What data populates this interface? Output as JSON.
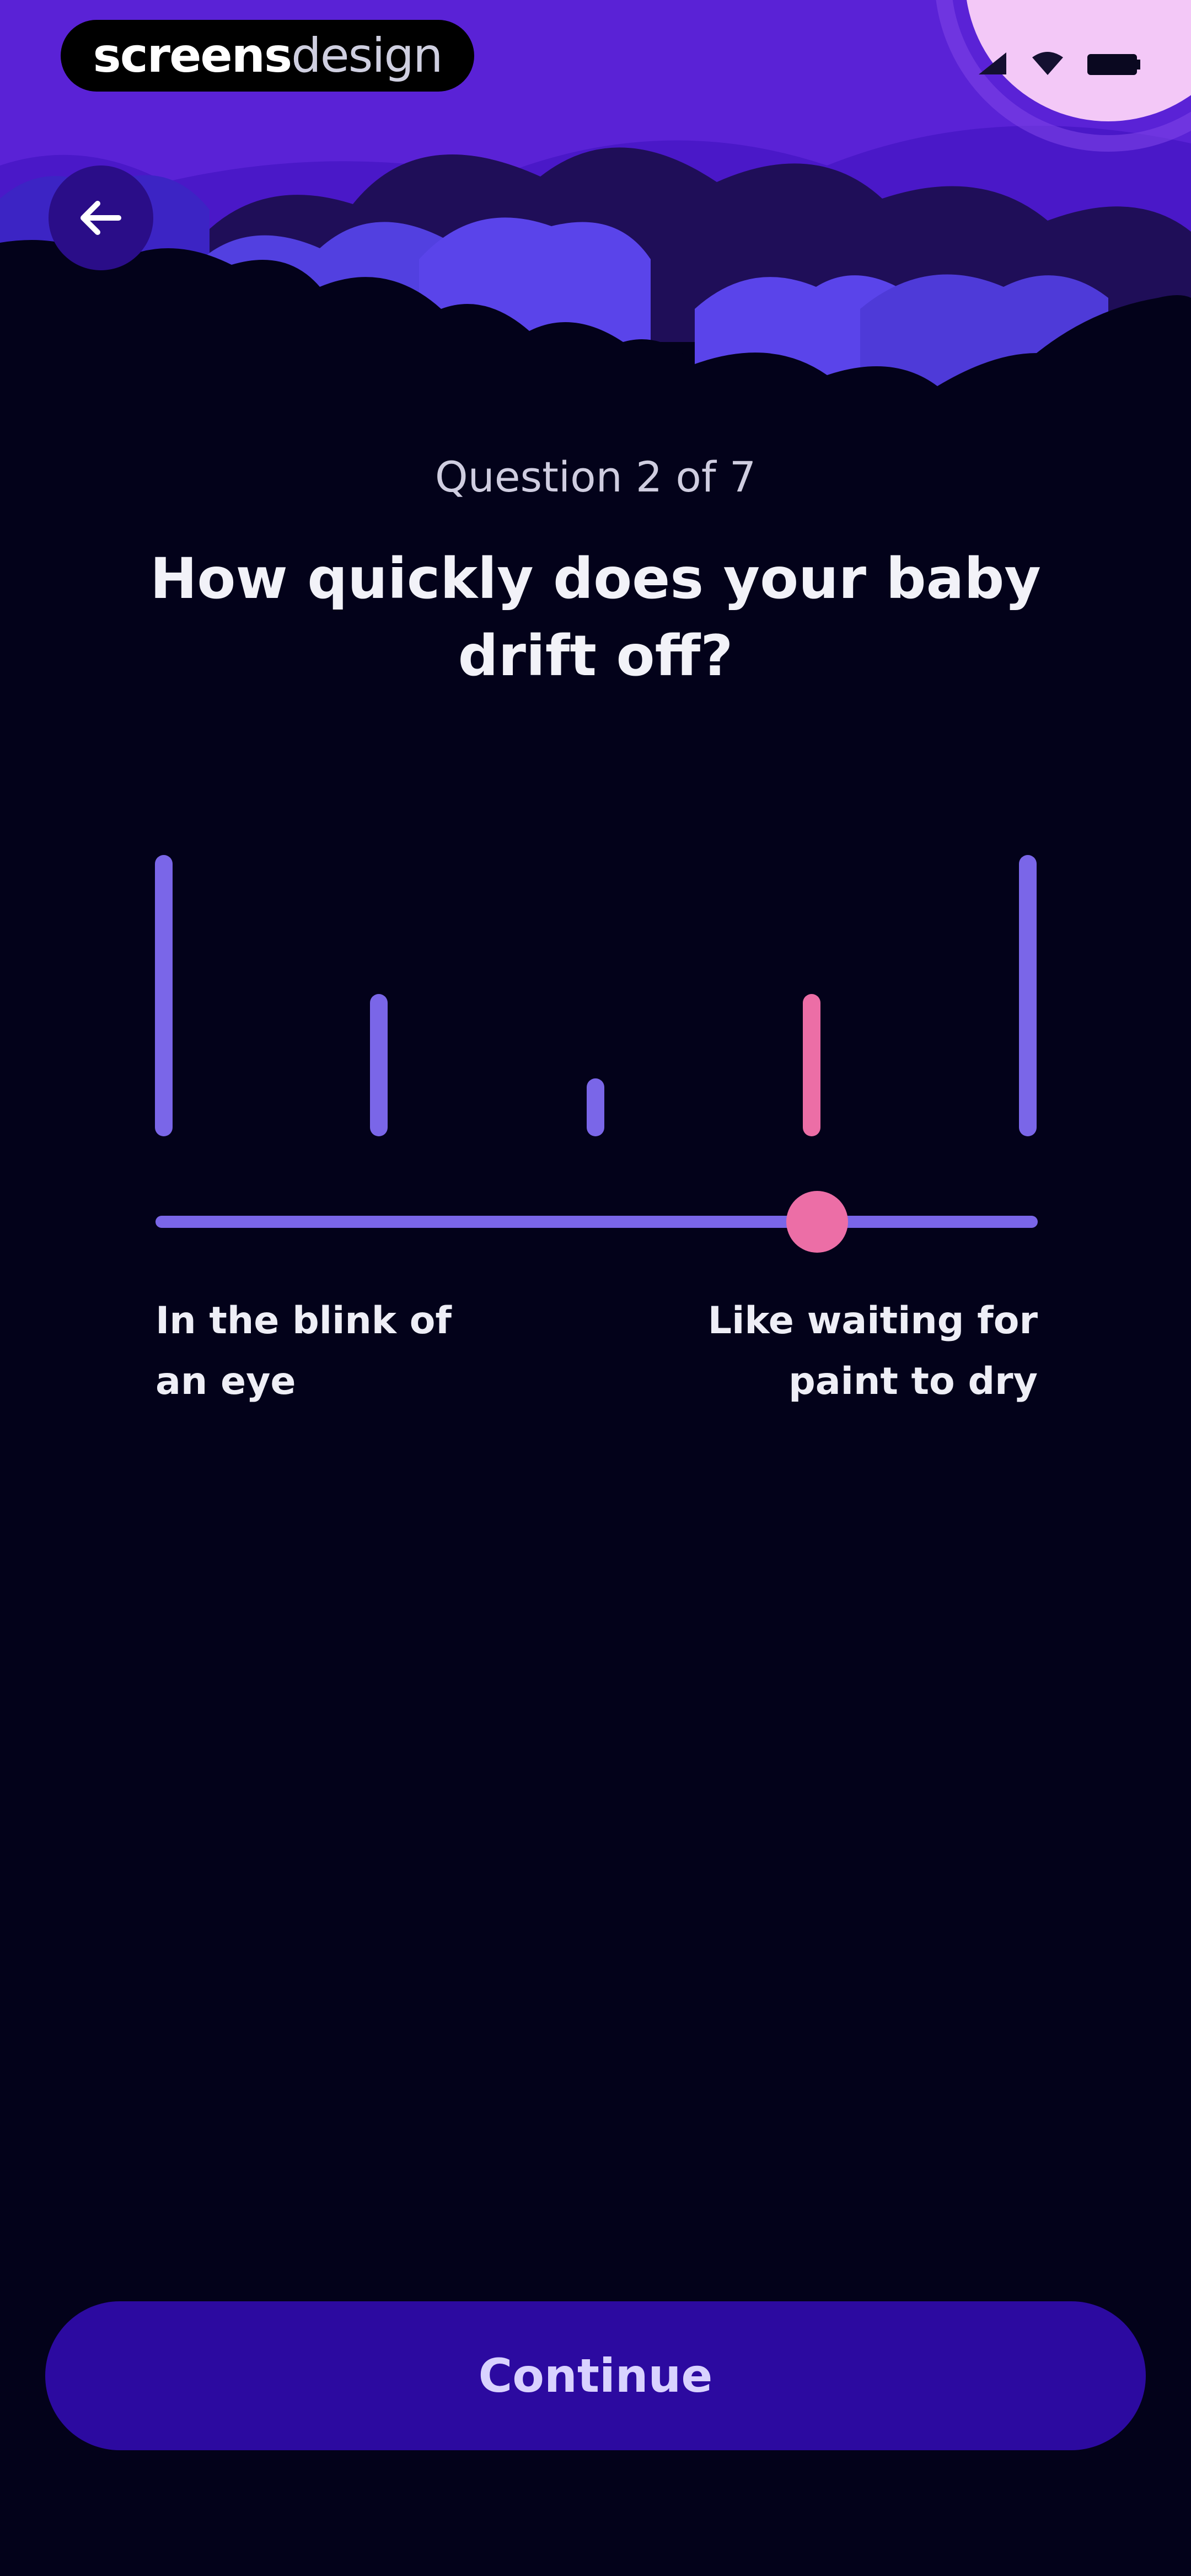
{
  "watermark": {
    "brand_strong": "screens",
    "brand_light": "design"
  },
  "header": {
    "progress_text": "Question 2 of 7",
    "question_text": "How quickly does your baby drift off?"
  },
  "slider": {
    "left_label": "In the blink of an eye",
    "right_label": "Like waiting for paint to dry",
    "selected_step": 4,
    "step_count": 5,
    "value_fraction": 0.75,
    "colors": {
      "track": "#7a66e8",
      "selected": "#ec6ea6"
    }
  },
  "footer": {
    "continue_label": "Continue",
    "continue_color": "#2c0aa0"
  },
  "icons": {
    "back": "arrow-left-icon",
    "signal": "signal-icon",
    "wifi": "wifi-icon",
    "battery": "battery-icon"
  }
}
